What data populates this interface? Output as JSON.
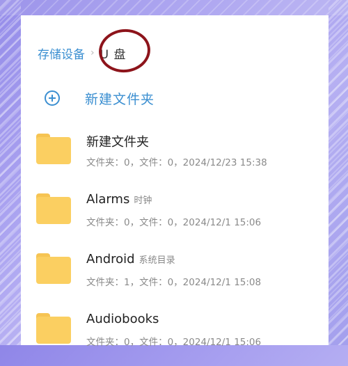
{
  "breadcrumb": {
    "root": "存储设备",
    "separator": "›",
    "current": "U 盘"
  },
  "actions": {
    "new_folder": "新建文件夹"
  },
  "items": [
    {
      "name": "新建文件夹",
      "tag": "",
      "meta": "文件夹：0，文件：0，2024/12/23 15:38"
    },
    {
      "name": "Alarms",
      "tag": "时钟",
      "meta": "文件夹：0，文件：0，2024/12/1 15:06"
    },
    {
      "name": "Android",
      "tag": "系统目录",
      "meta": "文件夹：1，文件：0，2024/12/1 15:08"
    },
    {
      "name": "Audiobooks",
      "tag": "",
      "meta": "文件夹：0，文件：0，2024/12/1 15:06"
    }
  ],
  "colors": {
    "accent": "#3b8fd1",
    "folder": "#fbcf61",
    "annotation": "#8d141b"
  },
  "icons": {
    "new_folder": "plus-circle-icon",
    "folder": "folder-icon",
    "separator": "chevron-right-icon"
  }
}
